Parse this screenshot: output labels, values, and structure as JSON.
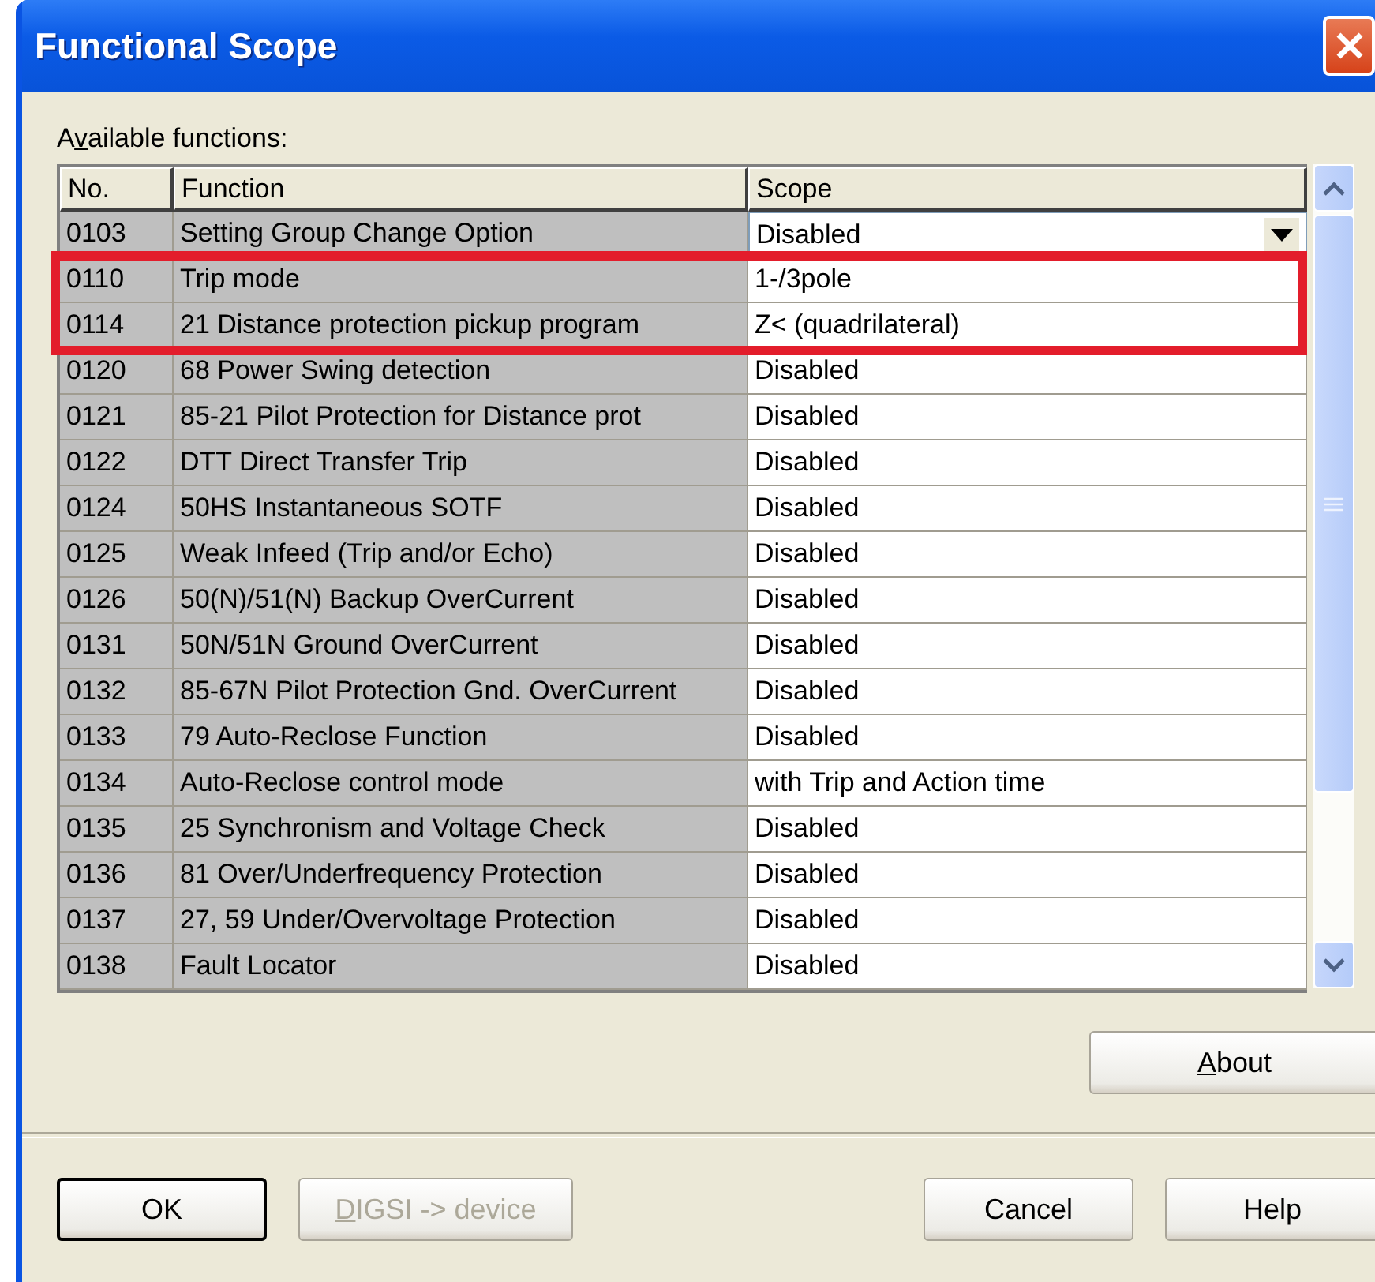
{
  "window": {
    "title": "Functional Scope"
  },
  "list_label": {
    "before_key": "A",
    "access_key": "v",
    "after_key": "ailable functions:"
  },
  "table": {
    "columns": [
      "No.",
      "Function",
      "Scope"
    ],
    "rows": [
      {
        "no": "0103",
        "function": "Setting Group Change Option",
        "scope": "Disabled",
        "kind": "dropdown",
        "marked": false
      },
      {
        "no": "0110",
        "function": "Trip mode",
        "scope": "1-/3pole",
        "kind": "text",
        "marked": true
      },
      {
        "no": "0114",
        "function": "21 Distance protection pickup program",
        "scope": "Z< (quadrilateral)",
        "kind": "text",
        "marked": true
      },
      {
        "no": "0120",
        "function": "68 Power Swing detection",
        "scope": "Disabled",
        "kind": "text",
        "marked": false
      },
      {
        "no": "0121",
        "function": "85-21 Pilot Protection for Distance prot",
        "scope": "Disabled",
        "kind": "text",
        "marked": false
      },
      {
        "no": "0122",
        "function": "DTT Direct Transfer Trip",
        "scope": "Disabled",
        "kind": "text",
        "marked": false
      },
      {
        "no": "0124",
        "function": "50HS Instantaneous SOTF",
        "scope": "Disabled",
        "kind": "text",
        "marked": false
      },
      {
        "no": "0125",
        "function": "Weak Infeed (Trip and/or Echo)",
        "scope": "Disabled",
        "kind": "text",
        "marked": false
      },
      {
        "no": "0126",
        "function": "50(N)/51(N) Backup OverCurrent",
        "scope": "Disabled",
        "kind": "text",
        "marked": false
      },
      {
        "no": "0131",
        "function": "50N/51N Ground OverCurrent",
        "scope": "Disabled",
        "kind": "text",
        "marked": false
      },
      {
        "no": "0132",
        "function": "85-67N Pilot Protection Gnd. OverCurrent",
        "scope": "Disabled",
        "kind": "text",
        "marked": false
      },
      {
        "no": "0133",
        "function": "79 Auto-Reclose Function",
        "scope": "Disabled",
        "kind": "text",
        "marked": false
      },
      {
        "no": "0134",
        "function": "Auto-Reclose control mode",
        "scope": "with Trip and Action time",
        "kind": "text",
        "marked": false
      },
      {
        "no": "0135",
        "function": "25 Synchronism and Voltage Check",
        "scope": "Disabled",
        "kind": "text",
        "marked": false
      },
      {
        "no": "0136",
        "function": "81 Over/Underfrequency Protection",
        "scope": "Disabled",
        "kind": "text",
        "marked": false
      },
      {
        "no": "0137",
        "function": "27, 59 Under/Overvoltage Protection",
        "scope": "Disabled",
        "kind": "text",
        "marked": false
      },
      {
        "no": "0138",
        "function": "Fault Locator",
        "scope": "Disabled",
        "kind": "text",
        "marked": false
      }
    ]
  },
  "about_button": {
    "access_key": "A",
    "after_key": "bout"
  },
  "buttons": [
    {
      "label": "OK",
      "kind": "default",
      "disabled": false
    },
    {
      "access_key": "D",
      "after_key": "IGSI -> device",
      "kind": "normal",
      "disabled": true
    },
    {
      "label": "Cancel",
      "kind": "normal",
      "disabled": false
    },
    {
      "label": "Help",
      "kind": "normal",
      "disabled": false
    }
  ]
}
